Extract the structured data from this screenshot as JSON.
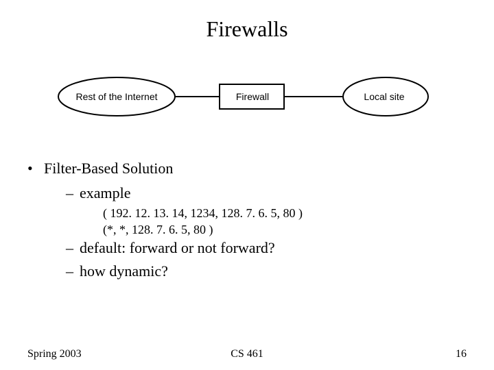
{
  "title": "Firewalls",
  "diagram": {
    "internet_label": "Rest of the Internet",
    "firewall_label": "Firewall",
    "local_label": "Local site"
  },
  "bullets": {
    "l1": "Filter-Based Solution",
    "l2a": "example",
    "code1": "( 192. 12. 13. 14, 1234, 128. 7. 6. 5, 80 )",
    "code2": "(*, *, 128. 7. 6. 5, 80 )",
    "l2b": "default: forward or not forward?",
    "l2c": "how dynamic?"
  },
  "footer": {
    "left": "Spring 2003",
    "center": "CS 461",
    "right": "16"
  }
}
